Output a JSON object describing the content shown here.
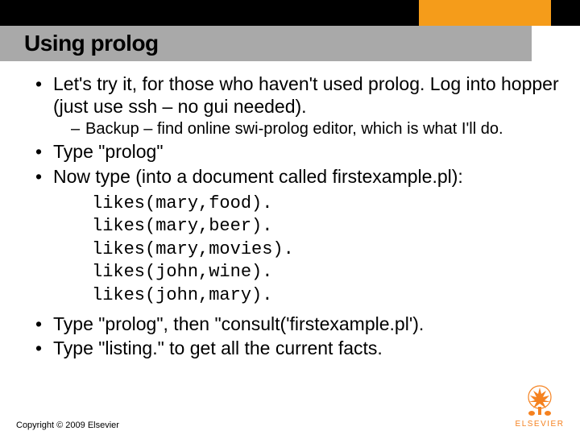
{
  "header": {
    "title": "Using prolog"
  },
  "bullets": {
    "b1": "Let's try it, for those who haven't used prolog.  Log into hopper (just use ssh – no gui needed).",
    "b1_sub1": "Backup – find online swi-prolog editor, which is what I'll do.",
    "b2": "Type \"prolog\"",
    "b3": "Now type (into a document called firstexample.pl):",
    "code": "likes(mary,food).\nlikes(mary,beer).\nlikes(mary,movies).\nlikes(john,wine).\nlikes(john,mary).",
    "b4": "Type \"prolog\", then \"consult('firstexample.pl').",
    "b5": "Type \"listing.\" to get all the current facts."
  },
  "footer": {
    "copyright": "Copyright © 2009 Elsevier",
    "logo_text": "ELSEVIER"
  }
}
